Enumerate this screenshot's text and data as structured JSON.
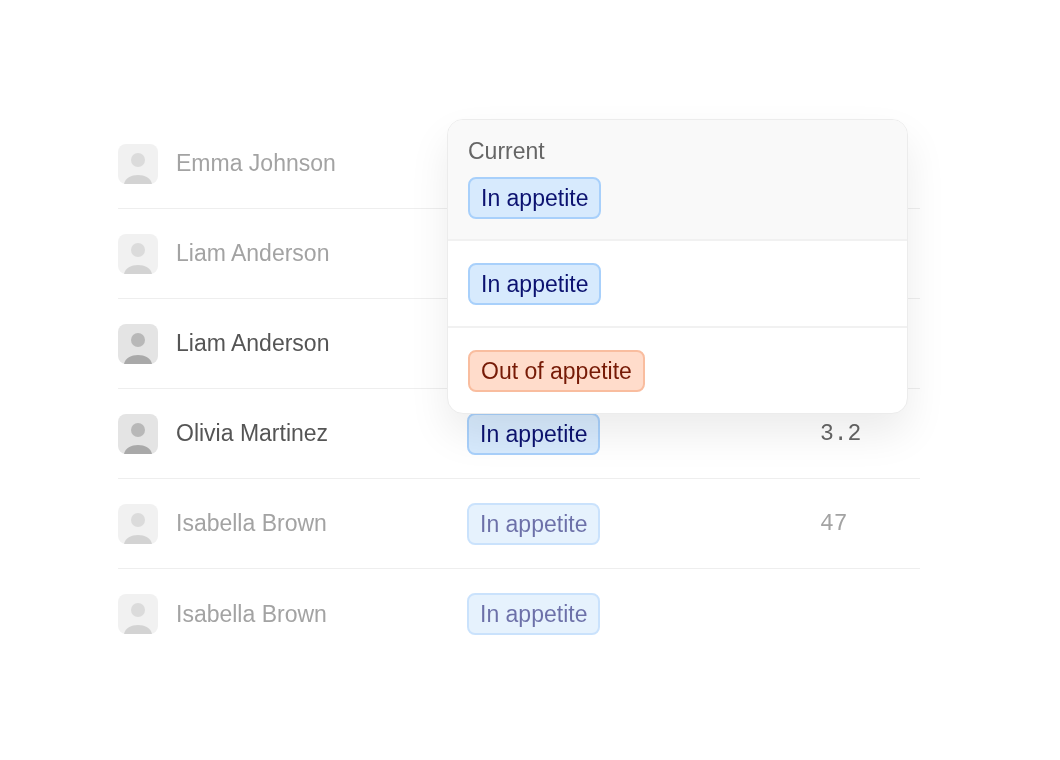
{
  "table": {
    "rows": [
      {
        "name": "Emma Johnson",
        "dimmed": true
      },
      {
        "name": "Liam Anderson",
        "dimmed": true
      },
      {
        "name": "Liam Anderson",
        "dimmed": false
      },
      {
        "name": "Olivia Martinez",
        "dimmed": false,
        "status": {
          "label": "In appetite",
          "kind": "positive"
        },
        "value": "3.2"
      },
      {
        "name": "Isabella Brown",
        "dimmed": true,
        "status": {
          "label": "In appetite",
          "kind": "positive"
        },
        "value": "47"
      },
      {
        "name": "Isabella Brown",
        "dimmed": true,
        "status": {
          "label": "In appetite",
          "kind": "positive"
        }
      }
    ]
  },
  "status_menu": {
    "current_label": "Current",
    "current": {
      "label": "In appetite",
      "kind": "positive"
    },
    "options": [
      {
        "label": "In appetite",
        "kind": "positive"
      },
      {
        "label": "Out of appetite",
        "kind": "negative"
      }
    ]
  }
}
